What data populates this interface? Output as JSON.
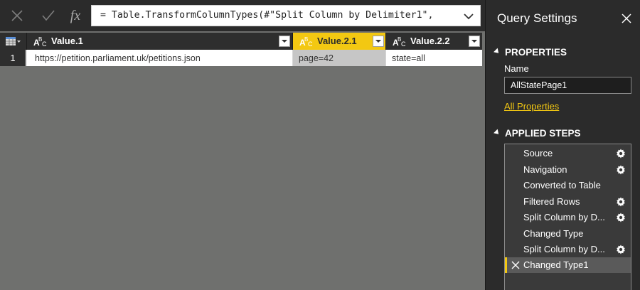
{
  "formula_bar": {
    "formula": "= Table.TransformColumnTypes(#\"Split Column by Delimiter1\","
  },
  "grid": {
    "columns": [
      {
        "type": "ABC",
        "name": "Value.1"
      },
      {
        "type": "ABC",
        "name": "Value.2.1"
      },
      {
        "type": "ABC",
        "name": "Value.2.2"
      }
    ],
    "rows": [
      {
        "num": "1",
        "cells": [
          "https://petition.parliament.uk/petitions.json",
          "page=42",
          "state=all"
        ]
      }
    ]
  },
  "query_settings": {
    "title": "Query Settings",
    "properties_heading": "PROPERTIES",
    "name_label": "Name",
    "name_value": "AllStatePage1",
    "all_properties_link": "All Properties",
    "applied_steps_heading": "APPLIED STEPS",
    "steps": [
      {
        "label": "Source",
        "gear": true
      },
      {
        "label": "Navigation",
        "gear": true
      },
      {
        "label": "Converted to Table",
        "gear": false
      },
      {
        "label": "Filtered Rows",
        "gear": true
      },
      {
        "label": "Split Column by D...",
        "gear": true
      },
      {
        "label": "Changed Type",
        "gear": false
      },
      {
        "label": "Split Column by D...",
        "gear": true
      },
      {
        "label": "Changed Type1",
        "gear": false,
        "active": true
      }
    ]
  },
  "colors": {
    "accent": "#f3c812",
    "panel_bg": "#2b2b2b",
    "canvas_bg": "#6f706e"
  }
}
